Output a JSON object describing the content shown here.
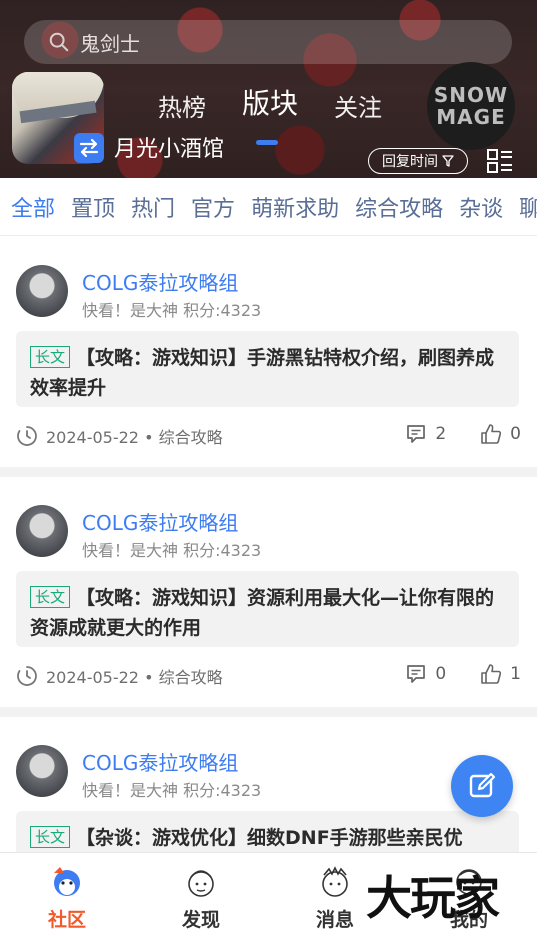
{
  "search": {
    "placeholder": "鬼剑士"
  },
  "header": {
    "tabs": [
      {
        "label": "热榜"
      },
      {
        "label": "版块"
      },
      {
        "label": "关注"
      }
    ],
    "board_name": "月光小酒馆",
    "sort_label": "回复时间",
    "badge_lines": [
      "SNOW",
      "MAGE"
    ]
  },
  "categories": [
    "全部",
    "置顶",
    "热门",
    "官方",
    "萌新求助",
    "综合攻略",
    "杂谈",
    "聊"
  ],
  "posts": [
    {
      "author": "COLG泰拉攻略组",
      "meta": "快看！是大神 积分:4323",
      "tag": "长文",
      "title": "【攻略：游戏知识】手游黑钻特权介绍，刷图养成效率提升",
      "date": "2024-05-22 • 综合攻略",
      "comments": "2",
      "likes": "0"
    },
    {
      "author": "COLG泰拉攻略组",
      "meta": "快看！是大神 积分:4323",
      "tag": "长文",
      "title": "【攻略：游戏知识】资源利用最大化—让你有限的资源成就更大的作用",
      "date": "2024-05-22 • 综合攻略",
      "comments": "0",
      "likes": "1"
    },
    {
      "author": "COLG泰拉攻略组",
      "meta": "快看！是大神 积分:4323",
      "tag": "长文",
      "title": "【杂谈：游戏优化】细数DNF手游那些亲民优",
      "date": "",
      "comments": "",
      "likes": ""
    }
  ],
  "nav": [
    {
      "label": "社区"
    },
    {
      "label": "发现"
    },
    {
      "label": "消息"
    },
    {
      "label": "我的"
    }
  ],
  "watermark": "大玩家",
  "colors": {
    "accent": "#3d7cf1",
    "tag": "#19a97b",
    "active_nav": "#f25a2c"
  }
}
